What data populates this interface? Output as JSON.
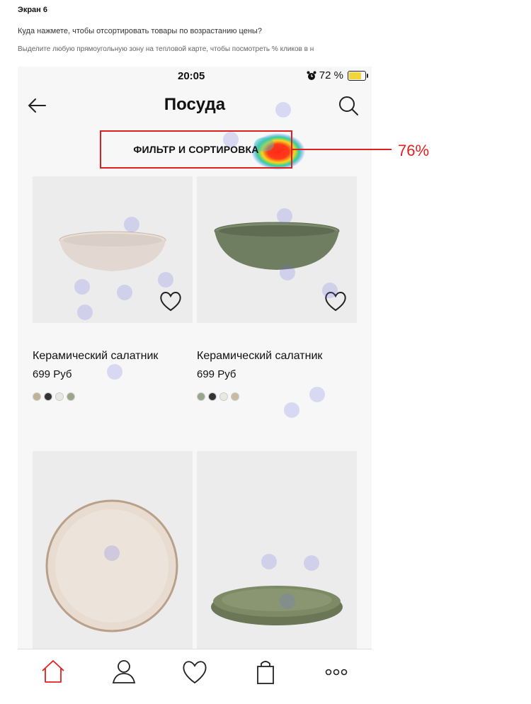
{
  "header": {
    "title": "Экран 6",
    "question": "Куда нажмете, чтобы отсортировать товары по возрастанию цены?",
    "hint": "Выделите любую прямоугольную зону на тепловой карте, чтобы посмотреть % кликов в н"
  },
  "status_bar": {
    "time": "20:05",
    "battery": "72 %",
    "battery_level": 0.72
  },
  "navbar": {
    "title": "Посуда"
  },
  "filter": {
    "label": "ФИЛЬТР И СОРТИРОВКА",
    "click_share": "76%"
  },
  "products": [
    {
      "name": "Керамический салатник",
      "price": "699 Руб",
      "swatches": [
        "#bfb396",
        "#333333",
        "#e9e9e2",
        "#9aa58b"
      ]
    },
    {
      "name": "Керамический салатник",
      "price": "699 Руб",
      "swatches": [
        "#9aa58b",
        "#333333",
        "#e9e9e2",
        "#c8bba0"
      ]
    }
  ],
  "tabbar": {
    "items": [
      "home-icon",
      "profile-icon",
      "favorites-icon",
      "bag-icon",
      "more-icon"
    ],
    "active_color": "#e02020"
  }
}
